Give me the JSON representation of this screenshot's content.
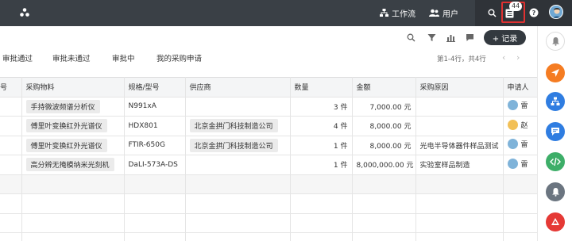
{
  "topbar": {
    "nav": [
      {
        "label": "工作流",
        "icon": "flow-icon"
      },
      {
        "label": "用户",
        "icon": "users-icon"
      }
    ],
    "badge_count": "44"
  },
  "toolbar": {
    "new_button": "+ 记录"
  },
  "tabs": [
    "审批通过",
    "审批未通过",
    "审批中",
    "我的采购申请"
  ],
  "pager": {
    "summary": "第1-4行，共4行"
  },
  "table": {
    "headers": [
      "号",
      "采购物料",
      "规格/型号",
      "供应商",
      "数量",
      "金额",
      "采购原因",
      "申请人"
    ],
    "rows": [
      {
        "material": "手持微波频谱分析仪",
        "model": "N991xA",
        "supplier": "",
        "qty": "3 件",
        "amount": "7,000.00 元",
        "reason": "",
        "applicant": "雷"
      },
      {
        "material": "傅里叶变换红外光谱仪",
        "model": "HDX801",
        "supplier": "北京金拱门科技制造公司",
        "qty": "4 件",
        "amount": "8,000.00 元",
        "reason": "",
        "applicant": "赵"
      },
      {
        "material": "傅里叶变换红外光谱仪",
        "model": "FTIR-650G",
        "supplier": "北京金拱门科技制造公司",
        "qty": "1 件",
        "amount": "8,000.00 元",
        "reason": "光电半导体器件样品测试",
        "applicant": "雷"
      },
      {
        "material": "高分辨无掩模纳米光刻机",
        "model": "DaLI-573A-DS",
        "supplier": "",
        "qty": "1 件",
        "amount": "8,000,000.00 元",
        "reason": "实验室样品制造",
        "applicant": "雷"
      }
    ]
  },
  "colors": {
    "topbar": "#3a4046",
    "accent_orange": "#f57c22",
    "accent_blue": "#2f7de1",
    "accent_green": "#3dae68",
    "highlight_red": "#e03131"
  },
  "rightbar_icons": [
    "bell-icon",
    "send-icon",
    "org-chart-icon",
    "chat-icon",
    "code-icon",
    "notification-icon",
    "app-logo-icon"
  ]
}
